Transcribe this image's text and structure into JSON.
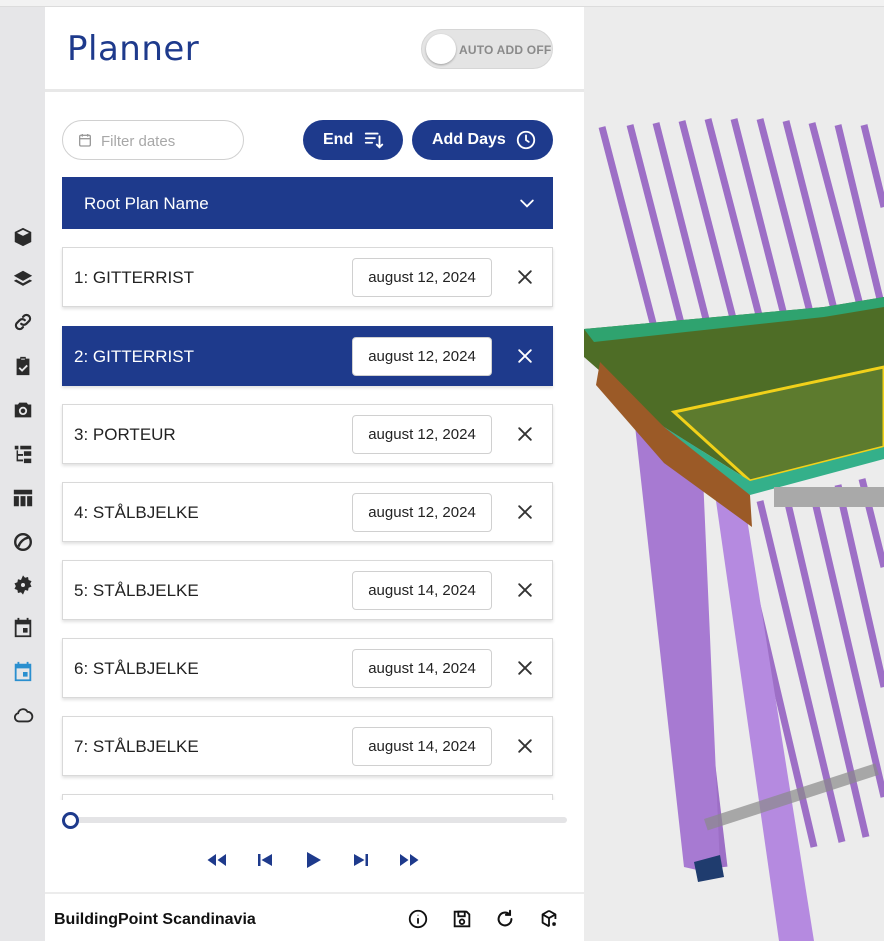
{
  "app": {
    "title": "Planner",
    "auto_add_label": "AUTO ADD OFF",
    "footer_brand": "BuildingPoint Scandinavia"
  },
  "toolbar": {
    "filter_placeholder": "Filter dates",
    "end_label": "End",
    "add_days_label": "Add Days"
  },
  "root_plan": {
    "label": "Root Plan Name"
  },
  "plan_items": [
    {
      "name": "1: GITTERRIST",
      "date": "august 12, 2024",
      "selected": false
    },
    {
      "name": "2: GITTERRIST",
      "date": "august 12, 2024",
      "selected": true
    },
    {
      "name": "3: PORTEUR",
      "date": "august 12, 2024",
      "selected": false
    },
    {
      "name": "4: STÅLBJELKE",
      "date": "august 12, 2024",
      "selected": false
    },
    {
      "name": "5: STÅLBJELKE",
      "date": "august 14, 2024",
      "selected": false
    },
    {
      "name": "6: STÅLBJELKE",
      "date": "august 14, 2024",
      "selected": false
    },
    {
      "name": "7: STÅLBJELKE",
      "date": "august 14, 2024",
      "selected": false
    }
  ],
  "timeline": {
    "position": 0
  },
  "sidebar_icons": [
    "cube-icon",
    "layers-icon",
    "link-icon",
    "clipboard-check-icon",
    "camera-icon",
    "hierarchy-icon",
    "table-icon",
    "shapes-icon",
    "badge-icon",
    "calendar-icon",
    "calendar-active-icon",
    "cloud-icon"
  ],
  "colors": {
    "primary": "#1e3a8c",
    "active_icon": "#2a8fcf"
  }
}
